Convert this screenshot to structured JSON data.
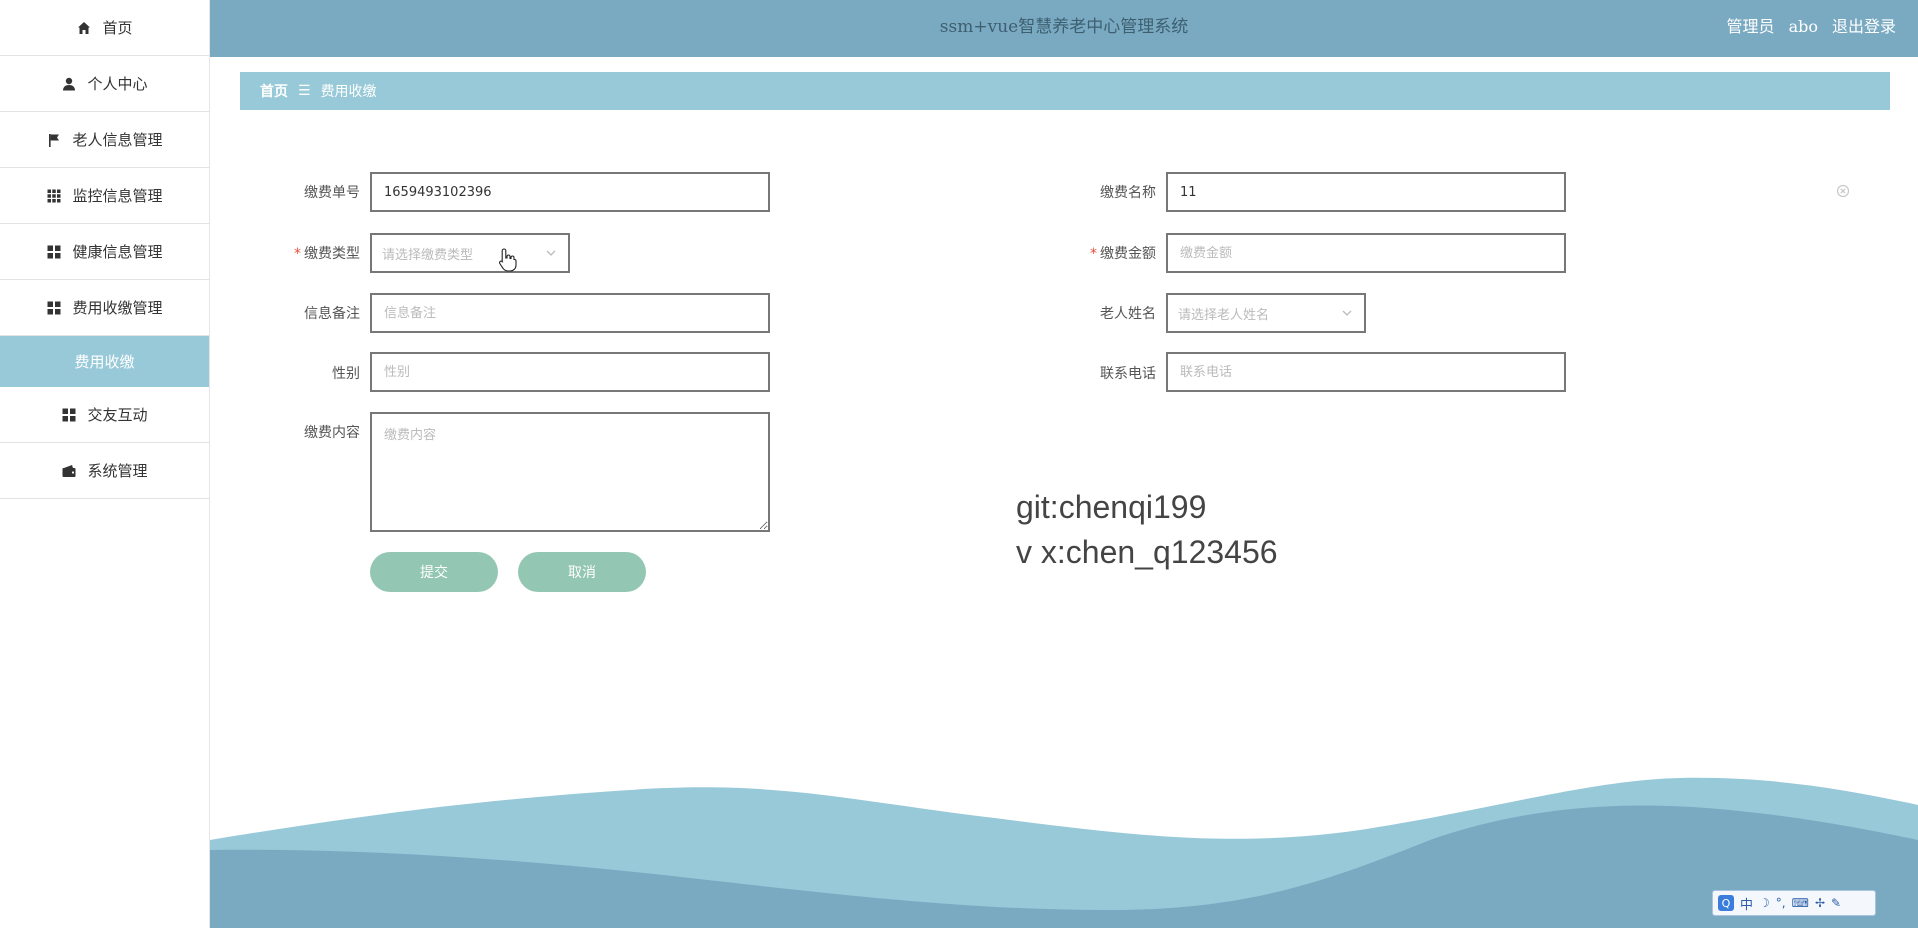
{
  "app": {
    "title": "ssm+vue智慧养老中心管理系统",
    "user_role": "管理员",
    "username": "abo",
    "logout_label": "退出登录"
  },
  "sidebar": {
    "items": [
      {
        "label": "首页",
        "icon": "home-icon"
      },
      {
        "label": "个人中心",
        "icon": "user-icon"
      },
      {
        "label": "老人信息管理",
        "icon": "flag-icon"
      },
      {
        "label": "监控信息管理",
        "icon": "grid-icon"
      },
      {
        "label": "健康信息管理",
        "icon": "tiles-icon"
      },
      {
        "label": "费用收缴管理",
        "icon": "tiles-icon"
      },
      {
        "label": "费用收缴",
        "icon": "",
        "active_sub": true
      },
      {
        "label": "交友互动",
        "icon": "tiles-icon"
      },
      {
        "label": "系统管理",
        "icon": "wallet-icon"
      }
    ]
  },
  "breadcrumb": {
    "home": "首页",
    "separator": "☰",
    "current": "费用收缴"
  },
  "form": {
    "order_no": {
      "label": "缴费单号",
      "value": "1659493102396",
      "placeholder": "缴费单号"
    },
    "fee_name": {
      "label": "缴费名称",
      "value": "11",
      "placeholder": "缴费名称"
    },
    "fee_type": {
      "label": "缴费类型",
      "placeholder": "请选择缴费类型",
      "required": true
    },
    "amount": {
      "label": "缴费金额",
      "value": "",
      "placeholder": "缴费金额",
      "required": true
    },
    "remark": {
      "label": "信息备注",
      "value": "",
      "placeholder": "信息备注"
    },
    "elder_name": {
      "label": "老人姓名",
      "placeholder": "请选择老人姓名"
    },
    "gender": {
      "label": "性别",
      "value": "",
      "placeholder": "性别"
    },
    "phone": {
      "label": "联系电话",
      "value": "",
      "placeholder": "联系电话"
    },
    "content": {
      "label": "缴费内容",
      "value": "",
      "placeholder": "缴费内容"
    },
    "required_mark": "*",
    "submit_label": "提交",
    "cancel_label": "取消"
  },
  "watermark": {
    "line1": "git:chenqi199",
    "line2": "v x:chen_q123456"
  },
  "ime": {
    "logo": "Q",
    "mode": "中",
    "glyphs": [
      "☽",
      "°,",
      "⌨",
      "✢",
      "✎"
    ]
  },
  "colors": {
    "header_bg": "#7aaac2",
    "breadcrumb_bg": "#98c9d8",
    "button_bg": "#93c6b3",
    "required": "#e74c3c"
  }
}
